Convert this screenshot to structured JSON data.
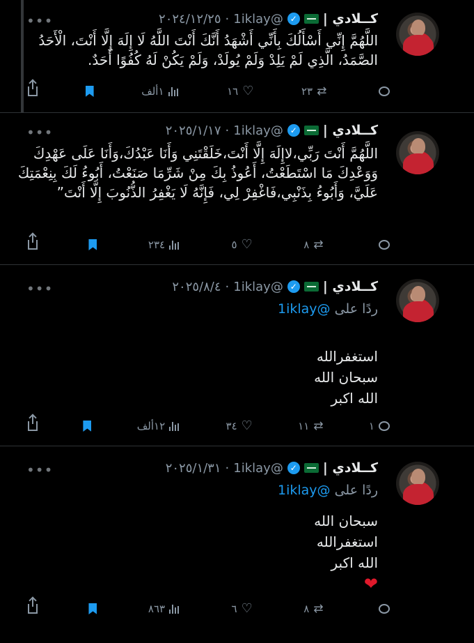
{
  "tweets": [
    {
      "name": "كــلادي |",
      "handle": "@1iklay",
      "date": "٢٠٢٤/١٢/٢٥",
      "text": "اللَّهُمَّ إِنِّي أَسْأَلُكَ بِأَنِّي أَشْهَدُ أَنَّكَ أَنْتَ اللَّهُ لَا إِلَهَ إِلَّا أَنْتَ، الْأَحَدُ الصَّمَدُ، الَّذِي لَمْ يَلِدْ وَلَمْ يُولَدْ، وَلَمْ يَكُنْ لَهُ كُفُوًا أَحَدٌ.",
      "replies": "",
      "retweets": "٢٣",
      "likes": "١٦",
      "views": "١ألف"
    },
    {
      "name": "كــلادي |",
      "handle": "@1iklay",
      "date": "٢٠٢٥/١/١٧",
      "text": "اللَّهُمَّ أَنْتَ رَبِّي،لاإِلَهَ إِلَّا أَنْتَ،خَلَقْتَنِي وَأَنَا عَبْدُكَ،وَأَنَا عَلَى عَهْدِكَ وَوَعْدِكَ مَا اسْتَطَعْتُ، أَعُوذُ بِكَ مِنْ شَرِّمَا صَنَعْتُ، أَبُوءُ لَكَ بِنِعْمَتِكَ عَلَيَّ، وَأَبُوءُ بِذَنْبِي،فَاغْفِرْ لِي، فَإِنَّهُ لَا يَغْفِرُ الذُّنُوبَ إِلَّا أَنْتَ”",
      "replies": "",
      "retweets": "٨",
      "likes": "٥",
      "views": "٢٣٤"
    },
    {
      "name": "كــلادي |",
      "handle": "@1iklay",
      "date": "٢٠٢٥/٨/٤",
      "reply_prefix": "ردًا على",
      "reply_to": "@1iklay",
      "lines": [
        "استغفرالله",
        "سبحان الله",
        "الله اكبر"
      ],
      "replies": "١",
      "retweets": "١١",
      "likes": "٣٤",
      "views": "١٢ألف"
    },
    {
      "name": "كــلادي |",
      "handle": "@1iklay",
      "date": "٢٠٢٥/١/٣١",
      "reply_prefix": "ردًا على",
      "reply_to": "@1iklay",
      "lines": [
        "سبحان الله",
        "استغفرالله",
        "الله اكبر"
      ],
      "emoji": "❤",
      "replies": "",
      "retweets": "٨",
      "likes": "٦",
      "views": "٨٦٣"
    }
  ],
  "icons": {
    "more": "more-icon",
    "verified": "verified-badge-icon",
    "flag": "saudi-flag-icon",
    "reply": "reply-icon",
    "retweet": "retweet-icon",
    "like": "like-icon",
    "views": "views-icon",
    "bookmark": "bookmark-icon",
    "share": "share-icon"
  },
  "colors": {
    "background": "#000000",
    "accent": "#1d9bf0",
    "muted": "#8b98a5"
  }
}
